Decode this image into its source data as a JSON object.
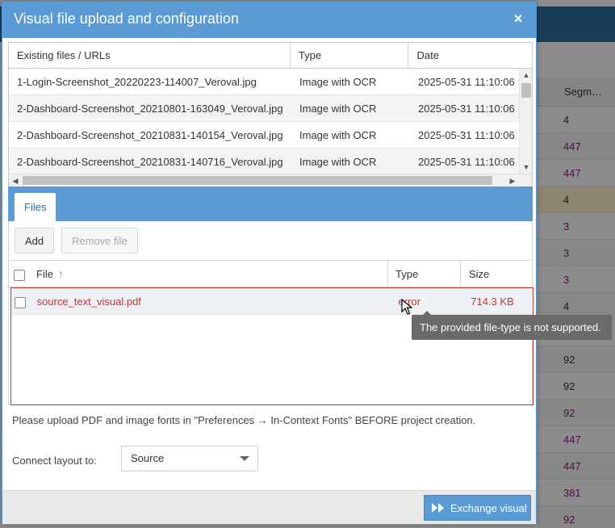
{
  "window": {
    "title": "Visual file upload and configuration",
    "close_glyph": "×"
  },
  "background": {
    "column_header": "Segm…",
    "values": [
      {
        "v": "4",
        "plain": true
      },
      {
        "v": "447",
        "plain": false
      },
      {
        "v": "447",
        "plain": false
      },
      {
        "v": "4",
        "plain": true,
        "highlight": true
      },
      {
        "v": "3",
        "plain": false
      },
      {
        "v": "3",
        "plain": false
      },
      {
        "v": "3",
        "plain": false
      },
      {
        "v": "4",
        "plain": true
      },
      {
        "v": "",
        "plain": true
      },
      {
        "v": "92",
        "plain": true
      },
      {
        "v": "92",
        "plain": true
      },
      {
        "v": "92",
        "plain": false
      },
      {
        "v": "447",
        "plain": false
      },
      {
        "v": "447",
        "plain": false
      },
      {
        "v": "381",
        "plain": false
      },
      {
        "v": "92",
        "plain": false
      }
    ]
  },
  "existing_files": {
    "columns": [
      "Existing files / URLs",
      "Type",
      "Date"
    ],
    "rows": [
      {
        "name": "1-Login-Screenshot_20220223-114007_Veroval.jpg",
        "type": "Image with OCR",
        "date": "2025-05-31 11:10:06"
      },
      {
        "name": "2-Dashboard-Screenshot_20210801-163049_Veroval.jpg",
        "type": "Image with OCR",
        "date": "2025-05-31 11:10:06"
      },
      {
        "name": "2-Dashboard-Screenshot_20210831-140154_Veroval.jpg",
        "type": "Image with OCR",
        "date": "2025-05-31 11:10:06"
      },
      {
        "name": "2-Dashboard-Screenshot_20210831-140716_Veroval.jpg",
        "type": "Image with OCR",
        "date": "2025-05-31 11:10:06"
      }
    ]
  },
  "files_panel": {
    "tab_label": "Files",
    "add_label": "Add",
    "remove_label": "Remove file",
    "columns": {
      "file": "File",
      "type": "Type",
      "size": "Size"
    },
    "rows": [
      {
        "name": "source_text_visual.pdf",
        "type": "error",
        "size": "714.3 KB"
      }
    ],
    "tooltip": "The provided file-type is not supported."
  },
  "note": "Please upload PDF and image fonts in \"Preferences → In-Context Fonts\" BEFORE project creation.",
  "connect": {
    "label": "Connect layout to:",
    "value": "Source"
  },
  "footer": {
    "primary_label": "Exchange visual"
  },
  "colors": {
    "accent": "#5b9bd5",
    "error": "#d0312d",
    "purple_value": "#8e1a8e"
  }
}
